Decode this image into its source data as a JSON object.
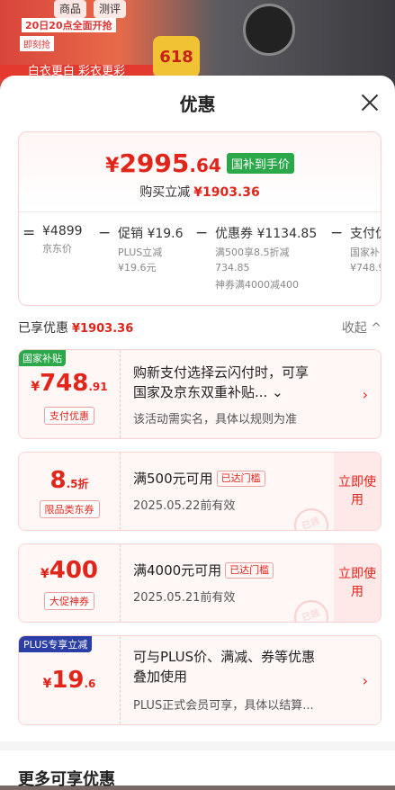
{
  "background": {
    "nav_tabs": [
      "商品",
      "测评"
    ],
    "banner_top": "20日20点全面开抢",
    "banner_sub": "即刻抢",
    "promo_badge": "618",
    "red_banner": "白衣更白 彩衣更彩"
  },
  "sheet": {
    "title": "优惠",
    "summary": {
      "final_symbol": "¥",
      "final_int": "2995",
      "final_dec": ".64",
      "badge": "国补到手价",
      "save_label": "购买立减",
      "save_amount": "¥1903.36"
    },
    "formula": {
      "items": [
        {
          "op": "=",
          "main": "¥4899",
          "sub1": "京东价",
          "sub2": "",
          "sub3": ""
        },
        {
          "op": "−",
          "main": "促销 ¥19.6",
          "sub1": "PLUS立减",
          "sub2": "¥19.6元",
          "sub3": ""
        },
        {
          "op": "−",
          "main": "优惠券 ¥1134.85",
          "sub1": "满500享8.5折减",
          "sub2": "734.85",
          "sub3": "神券满4000减400"
        },
        {
          "op": "−",
          "main": "支付优",
          "sub1": "国家补",
          "sub2": "¥748.9",
          "sub3": ""
        }
      ]
    },
    "enjoyed": {
      "label": "已享优惠",
      "amount": "¥1903.36",
      "collapse": "收起 ^"
    },
    "coupons": [
      {
        "tag": "国家补贴",
        "symbol": "¥",
        "big": "748",
        "dec": ".91",
        "chip": "支付优惠",
        "title_line1": "购新支付选择云闪付时，可享",
        "title_line2": "国家及京东双重补贴... ⌄",
        "desc": "该活动需实名，具体以规则为准"
      },
      {
        "symbol": "",
        "big": "8",
        "dec": ".5折",
        "chip": "限品类东券",
        "title": "满500元可用",
        "reach": "已达门槛",
        "desc": "2025.05.22前有效",
        "button": "立即使用",
        "stamp": "已领"
      },
      {
        "symbol": "¥",
        "big": "400",
        "dec": "",
        "chip": "大促神券",
        "title": "满4000元可用",
        "reach": "已达门槛",
        "desc": "2025.05.21前有效",
        "button": "立即使用",
        "stamp": "已领"
      },
      {
        "tag": "PLUS专享立减",
        "symbol": "¥",
        "big": "19",
        "dec": ".6",
        "title_line1": "可与PLUS价、满减、券等优惠",
        "title_line2": "叠加使用",
        "desc": "PLUS正式会员可享，具体以结算..."
      }
    ],
    "more_title": "更多可享优惠"
  },
  "colors": {
    "accent": "#e1251b",
    "green": "#2aa84a",
    "plus_blue": "#2b3ea5"
  }
}
